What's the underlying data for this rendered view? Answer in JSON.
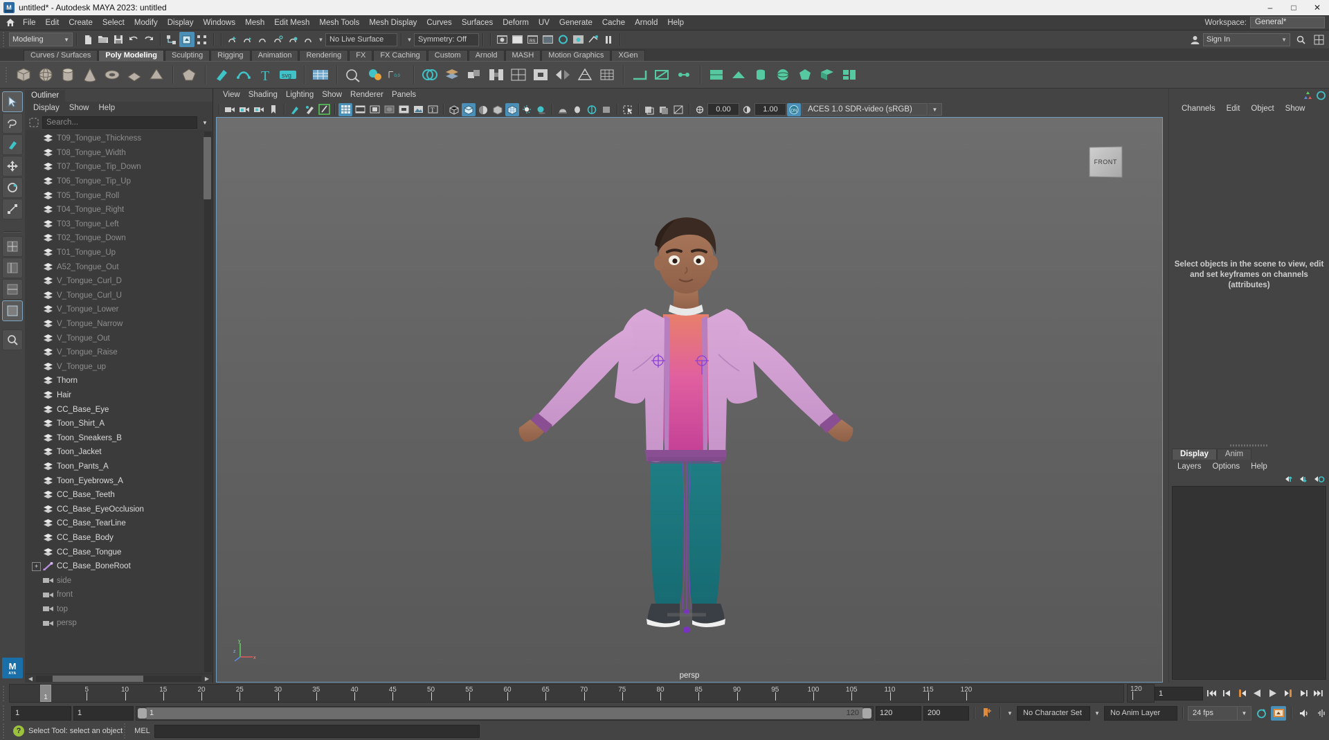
{
  "window": {
    "title": "untitled* - Autodesk MAYA 2023: untitled",
    "minimize": "–",
    "maximize": "□",
    "close": "✕"
  },
  "menubar": {
    "items": [
      "File",
      "Edit",
      "Create",
      "Select",
      "Modify",
      "Display",
      "Windows",
      "Mesh",
      "Edit Mesh",
      "Mesh Tools",
      "Mesh Display",
      "Curves",
      "Surfaces",
      "Deform",
      "UV",
      "Generate",
      "Cache",
      "Arnold",
      "Help"
    ],
    "workspace_label": "Workspace:",
    "workspace_value": "General*"
  },
  "statusline": {
    "menu_set": "Modeling",
    "live_surface": "No Live Surface",
    "symmetry": "Symmetry: Off",
    "signin": "Sign In"
  },
  "shelf": {
    "tabs": [
      "Curves / Surfaces",
      "Poly Modeling",
      "Sculpting",
      "Rigging",
      "Animation",
      "Rendering",
      "FX",
      "FX Caching",
      "Custom",
      "Arnold",
      "MASH",
      "Motion Graphics",
      "XGen"
    ],
    "active_tab": "Poly Modeling"
  },
  "outliner": {
    "tab": "Outliner",
    "menus": [
      "Display",
      "Show",
      "Help"
    ],
    "search_placeholder": "Search...",
    "items": [
      {
        "label": "persp",
        "icon": "camera-icon",
        "dim": true,
        "indent": 1,
        "expand": false
      },
      {
        "label": "top",
        "icon": "camera-icon",
        "dim": true,
        "indent": 1,
        "expand": false
      },
      {
        "label": "front",
        "icon": "camera-icon",
        "dim": true,
        "indent": 1,
        "expand": false
      },
      {
        "label": "side",
        "icon": "camera-icon",
        "dim": true,
        "indent": 1,
        "expand": false
      },
      {
        "label": "CC_Base_BoneRoot",
        "icon": "joint-icon",
        "dim": false,
        "indent": 0,
        "expand": true
      },
      {
        "label": "CC_Base_Tongue",
        "icon": "mesh-icon",
        "dim": false,
        "indent": 1,
        "expand": false
      },
      {
        "label": "CC_Base_Body",
        "icon": "mesh-icon",
        "dim": false,
        "indent": 1,
        "expand": false
      },
      {
        "label": "CC_Base_TearLine",
        "icon": "mesh-icon",
        "dim": false,
        "indent": 1,
        "expand": false
      },
      {
        "label": "CC_Base_EyeOcclusion",
        "icon": "mesh-icon",
        "dim": false,
        "indent": 1,
        "expand": false
      },
      {
        "label": "CC_Base_Teeth",
        "icon": "mesh-icon",
        "dim": false,
        "indent": 1,
        "expand": false
      },
      {
        "label": "Toon_Eyebrows_A",
        "icon": "mesh-icon",
        "dim": false,
        "indent": 1,
        "expand": false
      },
      {
        "label": "Toon_Pants_A",
        "icon": "mesh-icon",
        "dim": false,
        "indent": 1,
        "expand": false
      },
      {
        "label": "Toon_Jacket",
        "icon": "mesh-icon",
        "dim": false,
        "indent": 1,
        "expand": false
      },
      {
        "label": "Toon_Sneakers_B",
        "icon": "mesh-icon",
        "dim": false,
        "indent": 1,
        "expand": false
      },
      {
        "label": "Toon_Shirt_A",
        "icon": "mesh-icon",
        "dim": false,
        "indent": 1,
        "expand": false
      },
      {
        "label": "CC_Base_Eye",
        "icon": "mesh-icon",
        "dim": false,
        "indent": 1,
        "expand": false
      },
      {
        "label": "Hair",
        "icon": "mesh-icon",
        "dim": false,
        "indent": 1,
        "expand": false
      },
      {
        "label": "Thorn",
        "icon": "mesh-icon",
        "dim": false,
        "indent": 1,
        "expand": false
      },
      {
        "label": "V_Tongue_up",
        "icon": "mesh-icon",
        "dim": true,
        "indent": 1,
        "expand": false
      },
      {
        "label": "V_Tongue_Raise",
        "icon": "mesh-icon",
        "dim": true,
        "indent": 1,
        "expand": false
      },
      {
        "label": "V_Tongue_Out",
        "icon": "mesh-icon",
        "dim": true,
        "indent": 1,
        "expand": false
      },
      {
        "label": "V_Tongue_Narrow",
        "icon": "mesh-icon",
        "dim": true,
        "indent": 1,
        "expand": false
      },
      {
        "label": "V_Tongue_Lower",
        "icon": "mesh-icon",
        "dim": true,
        "indent": 1,
        "expand": false
      },
      {
        "label": "V_Tongue_Curl_U",
        "icon": "mesh-icon",
        "dim": true,
        "indent": 1,
        "expand": false
      },
      {
        "label": "V_Tongue_Curl_D",
        "icon": "mesh-icon",
        "dim": true,
        "indent": 1,
        "expand": false
      },
      {
        "label": "A52_Tongue_Out",
        "icon": "mesh-icon",
        "dim": true,
        "indent": 1,
        "expand": false
      },
      {
        "label": "T01_Tongue_Up",
        "icon": "mesh-icon",
        "dim": true,
        "indent": 1,
        "expand": false
      },
      {
        "label": "T02_Tongue_Down",
        "icon": "mesh-icon",
        "dim": true,
        "indent": 1,
        "expand": false
      },
      {
        "label": "T03_Tongue_Left",
        "icon": "mesh-icon",
        "dim": true,
        "indent": 1,
        "expand": false
      },
      {
        "label": "T04_Tongue_Right",
        "icon": "mesh-icon",
        "dim": true,
        "indent": 1,
        "expand": false
      },
      {
        "label": "T05_Tongue_Roll",
        "icon": "mesh-icon",
        "dim": true,
        "indent": 1,
        "expand": false
      },
      {
        "label": "T06_Tongue_Tip_Up",
        "icon": "mesh-icon",
        "dim": true,
        "indent": 1,
        "expand": false
      },
      {
        "label": "T07_Tongue_Tip_Down",
        "icon": "mesh-icon",
        "dim": true,
        "indent": 1,
        "expand": false
      },
      {
        "label": "T08_Tongue_Width",
        "icon": "mesh-icon",
        "dim": true,
        "indent": 1,
        "expand": false
      },
      {
        "label": "T09_Tongue_Thickness",
        "icon": "mesh-icon",
        "dim": true,
        "indent": 1,
        "expand": false
      }
    ]
  },
  "viewport": {
    "menus": [
      "View",
      "Shading",
      "Lighting",
      "Show",
      "Renderer",
      "Panels"
    ],
    "exposure": "0.00",
    "gamma": "1.00",
    "color_space": "ACES 1.0 SDR-video (sRGB)",
    "camera_label": "persp",
    "viewcube_face": "FRONT",
    "axis_x": "x",
    "axis_y": "y",
    "axis_z": "z"
  },
  "channelbox": {
    "menus": [
      "Channels",
      "Edit",
      "Object",
      "Show"
    ],
    "empty_hint": "Select objects in the scene to view, edit and set keyframes on channels (attributes)"
  },
  "layers": {
    "tabs": [
      "Display",
      "Anim"
    ],
    "active_tab": "Display",
    "menus": [
      "Layers",
      "Options",
      "Help"
    ]
  },
  "timeslider": {
    "ticks": [
      5,
      10,
      15,
      20,
      25,
      30,
      35,
      40,
      45,
      50,
      55,
      60,
      65,
      70,
      75,
      80,
      85,
      90,
      95,
      100,
      105,
      110,
      115,
      120
    ],
    "current_frame": "1",
    "range_end_label": "120",
    "frame_field": "1"
  },
  "rangeslider": {
    "start_field": "1",
    "anim_start_field": "1",
    "range_start_label": "1",
    "range_end_label": "120",
    "playback_end": "120",
    "anim_end": "200",
    "character_set": "No Character Set",
    "anim_layer": "No Anim Layer",
    "fps": "24 fps"
  },
  "commandline": {
    "help_text": "Select Tool: select an object",
    "mel_label": "MEL",
    "mel_value": ""
  }
}
